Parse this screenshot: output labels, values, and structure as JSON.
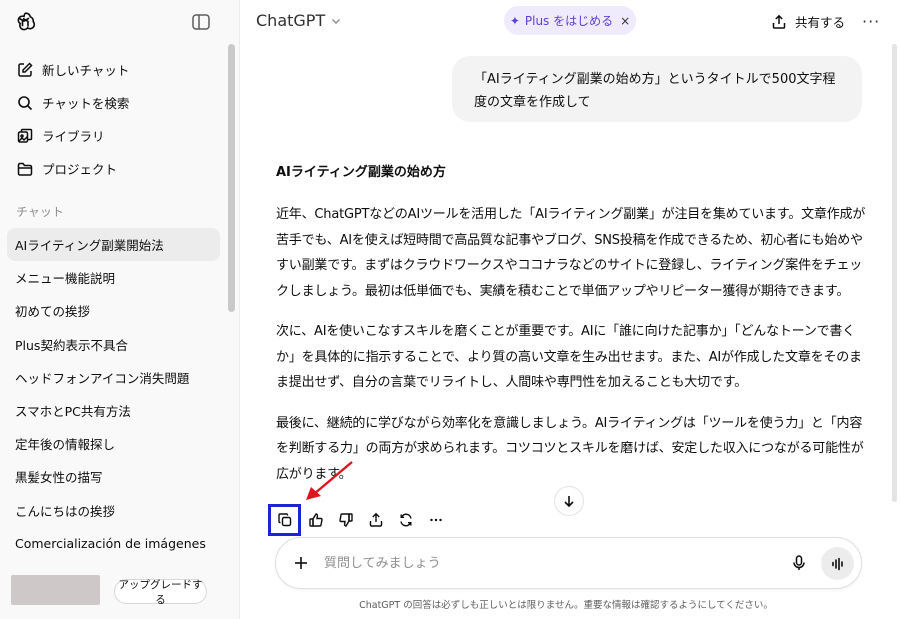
{
  "sidebar": {
    "nav": [
      {
        "label": "新しいチャット",
        "icon": "compose-icon"
      },
      {
        "label": "チャットを検索",
        "icon": "search-icon"
      },
      {
        "label": "ライブラリ",
        "icon": "library-icon"
      },
      {
        "label": "プロジェクト",
        "icon": "folder-icon"
      }
    ],
    "section_label": "チャット",
    "chats": [
      "AIライティング副業開始法",
      "メニュー機能説明",
      "初めての挨拶",
      "Plus契約表示不具合",
      "ヘッドフォンアイコン消失問題",
      "スマホとPC共有方法",
      "定年後の情報探し",
      "黒髪女性の描写",
      "こんにちはの挨拶",
      "Comercialización de imágenes"
    ],
    "active_chat_index": 0,
    "upgrade_label": "アップグレードする"
  },
  "header": {
    "model_name": "ChatGPT",
    "plus_label": "Plus をはじめる",
    "plus_close": "×",
    "share_label": "共有する",
    "more": "···"
  },
  "conversation": {
    "user_message": "「AIライティング副業の始め方」というタイトルで500文字程度の文章を作成して",
    "answer_title": "AIライティング副業の始め方",
    "paragraphs": [
      "近年、ChatGPTなどのAIツールを活用した「AIライティング副業」が注目を集めています。文章作成が苦手でも、AIを使えば短時間で高品質な記事やブログ、SNS投稿を作成できるため、初心者にも始めやすい副業です。まずはクラウドワークスやココナラなどのサイトに登録し、ライティング案件をチェックしましょう。最初は低単価でも、実績を積むことで単価アップやリピーター獲得が期待できます。",
      "次に、AIを使いこなすスキルを磨くことが重要です。AIに「誰に向けた記事か」「どんなトーンで書くか」を具体的に指示することで、より質の高い文章を生み出せます。また、AIが作成した文章をそのまま提出せず、自分の言葉でリライトし、人間味や専門性を加えることも大切です。",
      "最後に、継続的に学びながら効率化を意識しましょう。AIライティングは「ツールを使う力」と「内容を判断する力」の両方が求められます。コツコツとスキルを磨けば、安定した収入につながる可能性が広がります。"
    ]
  },
  "composer": {
    "placeholder": "質問してみましょう"
  },
  "footer": {
    "disclaimer": "ChatGPT の回答は必ずしも正しいとは限りません。重要な情報は確認するようにしてください。"
  },
  "colors": {
    "highlight_border": "#1a25d4",
    "annotation_arrow": "#e0141e",
    "plus_accent": "#5b3fd6"
  }
}
